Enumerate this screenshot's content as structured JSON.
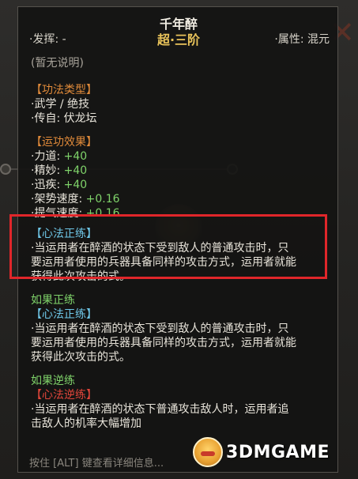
{
  "header": {
    "title": "千年醉",
    "rank": "超·三阶",
    "launch_label": "·发挥: -",
    "attribute_label": "·属性: 混元"
  },
  "description": "(暂无说明)",
  "skill_type": {
    "heading": "【功法类型】",
    "items": [
      "·武学 / 绝技",
      "·传自: 伏龙坛"
    ]
  },
  "effects": {
    "heading": "【运功效果】",
    "items": [
      {
        "label": "·力道:",
        "value": "+40"
      },
      {
        "label": "·精妙:",
        "value": "+40"
      },
      {
        "label": "·迅疾:",
        "value": "+40"
      },
      {
        "label": "·架势速度:",
        "value": "+0.16"
      },
      {
        "label": "·提气速度:",
        "value": "+0.16"
      }
    ]
  },
  "heart_method": {
    "heading": "【心法正练】",
    "lines": [
      "·当运用者在醉酒的状态下受到敌人的普通攻击时，只",
      "要运用者使用的兵器具备同样的攻击方式，运用者就能",
      "获得此次攻击的式。"
    ]
  },
  "if_forward": {
    "label": "如果正练",
    "heading": "【心法正练】",
    "lines": [
      "·当运用者在醉酒的状态下受到敌人的普通攻击时，只",
      "要运用者使用的兵器具备同样的攻击方式，运用者就能",
      "获得此次攻击的式。"
    ]
  },
  "if_reverse": {
    "label": "如果逆练",
    "heading": "【心法逆练】",
    "lines": [
      "·当运用者在醉酒的状态下普通攻击敌人时，运用者追",
      "击敌人的机率大幅增加"
    ]
  },
  "footer": "按住 [ALT] 键查看详细信息...",
  "watermark": "3DMGAME",
  "colors": {
    "accent_gold": "#e9c35a",
    "effect_green": "#7fd36a",
    "heading_orange": "#e08a3a",
    "heart_cyan": "#6fc7e8",
    "reverse_red": "#e0453a",
    "highlight_red": "#e0262a"
  }
}
